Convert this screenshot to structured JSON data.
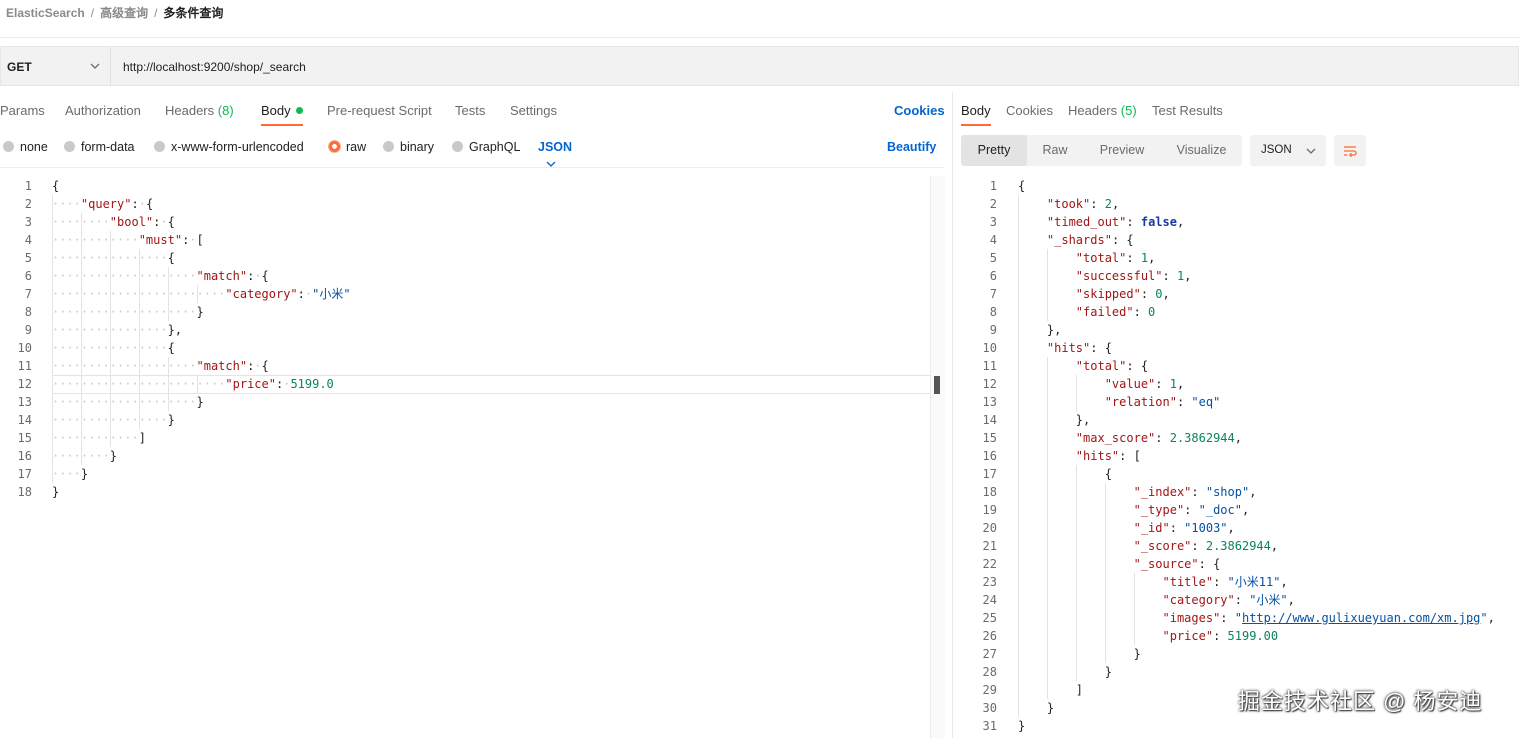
{
  "breadcrumb": {
    "items": [
      "ElasticSearch",
      "高级查询"
    ],
    "separator": "/",
    "current": "多条件查询"
  },
  "request": {
    "method": "GET",
    "url": "http://localhost:9200/shop/_search"
  },
  "request_tabs": {
    "params": "Params",
    "authorization": "Authorization",
    "headers": "Headers",
    "headers_count": "(8)",
    "body": "Body",
    "prerequest": "Pre-request Script",
    "tests": "Tests",
    "settings": "Settings",
    "cookies": "Cookies"
  },
  "body_types": {
    "none": "none",
    "form_data": "form-data",
    "urlencoded": "x-www-form-urlencoded",
    "raw": "raw",
    "binary": "binary",
    "graphql": "GraphQL",
    "selected_format": "JSON",
    "beautify": "Beautify"
  },
  "response_tabs": {
    "body": "Body",
    "cookies": "Cookies",
    "headers": "Headers",
    "headers_count": "(5)",
    "test_results": "Test Results"
  },
  "response_toolbar": {
    "pretty": "Pretty",
    "raw": "Raw",
    "preview": "Preview",
    "visualize": "Visualize",
    "format": "JSON"
  },
  "request_body_lines": [
    [
      [
        "p",
        "{"
      ]
    ],
    [
      [
        "k",
        "\"query\""
      ],
      [
        "p",
        ": {"
      ]
    ],
    [
      [
        "k",
        "\"bool\""
      ],
      [
        "p",
        ": {"
      ]
    ],
    [
      [
        "k",
        "\"must\""
      ],
      [
        "p",
        ": ["
      ]
    ],
    [
      [
        "p",
        "{"
      ]
    ],
    [
      [
        "k",
        "\"match\""
      ],
      [
        "p",
        ": {"
      ]
    ],
    [
      [
        "k",
        "\"category\""
      ],
      [
        "p",
        ": "
      ],
      [
        "s",
        "\"小米\""
      ]
    ],
    [
      [
        "p",
        "}"
      ]
    ],
    [
      [
        "p",
        "},"
      ]
    ],
    [
      [
        "p",
        "{"
      ]
    ],
    [
      [
        "k",
        "\"match\""
      ],
      [
        "p",
        ": {"
      ]
    ],
    [
      [
        "k",
        "\"price\""
      ],
      [
        "p",
        ": "
      ],
      [
        "n",
        "5199.0"
      ]
    ],
    [
      [
        "p",
        "}"
      ]
    ],
    [
      [
        "p",
        "}"
      ]
    ],
    [
      [
        "p",
        "]"
      ]
    ],
    [
      [
        "p",
        "}"
      ]
    ],
    [
      [
        "p",
        "}"
      ]
    ],
    [
      [
        "p",
        "}"
      ]
    ]
  ],
  "response_body_lines": [
    [
      [
        "p",
        "{"
      ]
    ],
    [
      [
        "k",
        "\"took\""
      ],
      [
        "p",
        ": "
      ],
      [
        "n",
        "2"
      ],
      [
        "p",
        ","
      ]
    ],
    [
      [
        "k",
        "\"timed_out\""
      ],
      [
        "p",
        ": "
      ],
      [
        "b",
        "false"
      ],
      [
        "p",
        ","
      ]
    ],
    [
      [
        "k",
        "\"_shards\""
      ],
      [
        "p",
        ": {"
      ]
    ],
    [
      [
        "k",
        "\"total\""
      ],
      [
        "p",
        ": "
      ],
      [
        "n",
        "1"
      ],
      [
        "p",
        ","
      ]
    ],
    [
      [
        "k",
        "\"successful\""
      ],
      [
        "p",
        ": "
      ],
      [
        "n",
        "1"
      ],
      [
        "p",
        ","
      ]
    ],
    [
      [
        "k",
        "\"skipped\""
      ],
      [
        "p",
        ": "
      ],
      [
        "n",
        "0"
      ],
      [
        "p",
        ","
      ]
    ],
    [
      [
        "k",
        "\"failed\""
      ],
      [
        "p",
        ": "
      ],
      [
        "n",
        "0"
      ]
    ],
    [
      [
        "p",
        "},"
      ]
    ],
    [
      [
        "k",
        "\"hits\""
      ],
      [
        "p",
        ": {"
      ]
    ],
    [
      [
        "k",
        "\"total\""
      ],
      [
        "p",
        ": {"
      ]
    ],
    [
      [
        "k",
        "\"value\""
      ],
      [
        "p",
        ": "
      ],
      [
        "n",
        "1"
      ],
      [
        "p",
        ","
      ]
    ],
    [
      [
        "k",
        "\"relation\""
      ],
      [
        "p",
        ": "
      ],
      [
        "s",
        "\"eq\""
      ]
    ],
    [
      [
        "p",
        "},"
      ]
    ],
    [
      [
        "k",
        "\"max_score\""
      ],
      [
        "p",
        ": "
      ],
      [
        "n",
        "2.3862944"
      ],
      [
        "p",
        ","
      ]
    ],
    [
      [
        "k",
        "\"hits\""
      ],
      [
        "p",
        ": ["
      ]
    ],
    [
      [
        "p",
        "{"
      ]
    ],
    [
      [
        "k",
        "\"_index\""
      ],
      [
        "p",
        ": "
      ],
      [
        "s",
        "\"shop\""
      ],
      [
        "p",
        ","
      ]
    ],
    [
      [
        "k",
        "\"_type\""
      ],
      [
        "p",
        ": "
      ],
      [
        "s",
        "\"_doc\""
      ],
      [
        "p",
        ","
      ]
    ],
    [
      [
        "k",
        "\"_id\""
      ],
      [
        "p",
        ": "
      ],
      [
        "s",
        "\"1003\""
      ],
      [
        "p",
        ","
      ]
    ],
    [
      [
        "k",
        "\"_score\""
      ],
      [
        "p",
        ": "
      ],
      [
        "n",
        "2.3862944"
      ],
      [
        "p",
        ","
      ]
    ],
    [
      [
        "k",
        "\"_source\""
      ],
      [
        "p",
        ": {"
      ]
    ],
    [
      [
        "k",
        "\"title\""
      ],
      [
        "p",
        ": "
      ],
      [
        "s",
        "\"小米11\""
      ],
      [
        "p",
        ","
      ]
    ],
    [
      [
        "k",
        "\"category\""
      ],
      [
        "p",
        ": "
      ],
      [
        "s",
        "\"小米\""
      ],
      [
        "p",
        ","
      ]
    ],
    [
      [
        "k",
        "\"images\""
      ],
      [
        "p",
        ": "
      ],
      [
        "s",
        "\""
      ],
      [
        "u",
        "http://www.gulixueyuan.com/xm.jpg"
      ],
      [
        "s",
        "\""
      ],
      [
        "p",
        ","
      ]
    ],
    [
      [
        "k",
        "\"price\""
      ],
      [
        "p",
        ": "
      ],
      [
        "n",
        "5199.00"
      ]
    ],
    [
      [
        "p",
        "}"
      ]
    ],
    [
      [
        "p",
        "}"
      ]
    ],
    [
      [
        "p",
        "]"
      ]
    ],
    [
      [
        "p",
        "}"
      ]
    ],
    [
      [
        "p",
        "}"
      ]
    ]
  ],
  "watermark": "掘金技术社区 @ 杨安迪"
}
